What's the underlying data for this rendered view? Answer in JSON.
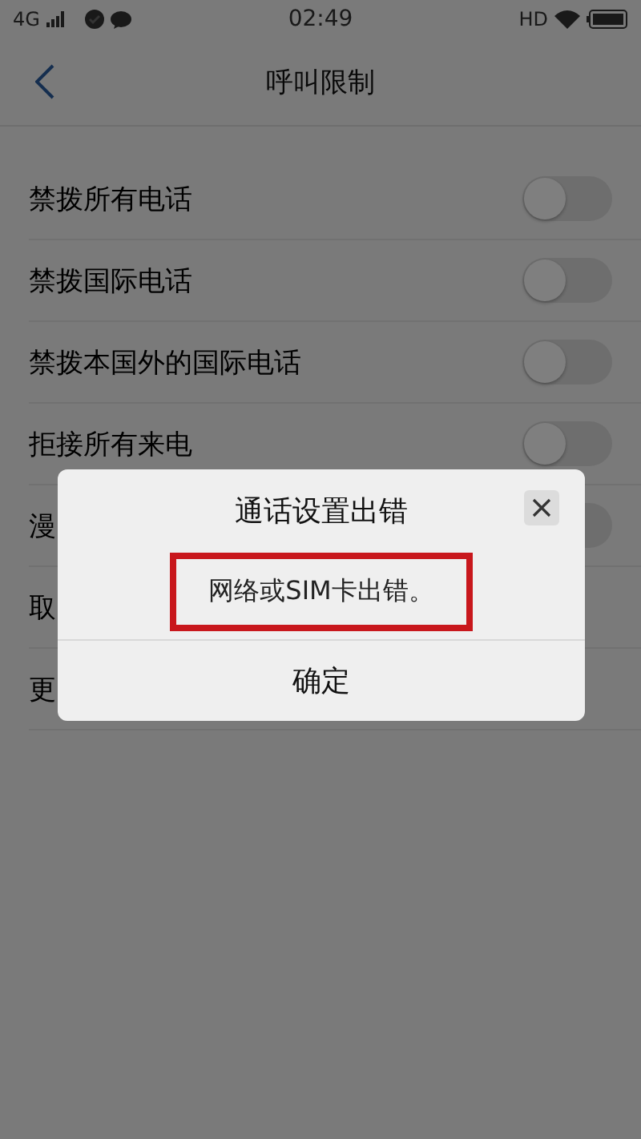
{
  "status_bar": {
    "network": "4G",
    "time": "02:49",
    "hd": "HD"
  },
  "header": {
    "title": "呼叫限制"
  },
  "rows": [
    {
      "label": "禁拨所有电话",
      "kind": "switch",
      "on": false
    },
    {
      "label": "禁拨国际电话",
      "kind": "switch",
      "on": false
    },
    {
      "label": "禁拨本国外的国际电话",
      "kind": "switch",
      "on": false
    },
    {
      "label": "拒接所有来电",
      "kind": "switch",
      "on": false
    },
    {
      "label": "漫",
      "kind": "switch",
      "on": false
    },
    {
      "label": "取",
      "kind": "link"
    },
    {
      "label": "更",
      "kind": "link"
    }
  ],
  "dialog": {
    "title": "通话设置出错",
    "message": "网络或SIM卡出错。",
    "button": "确定"
  }
}
